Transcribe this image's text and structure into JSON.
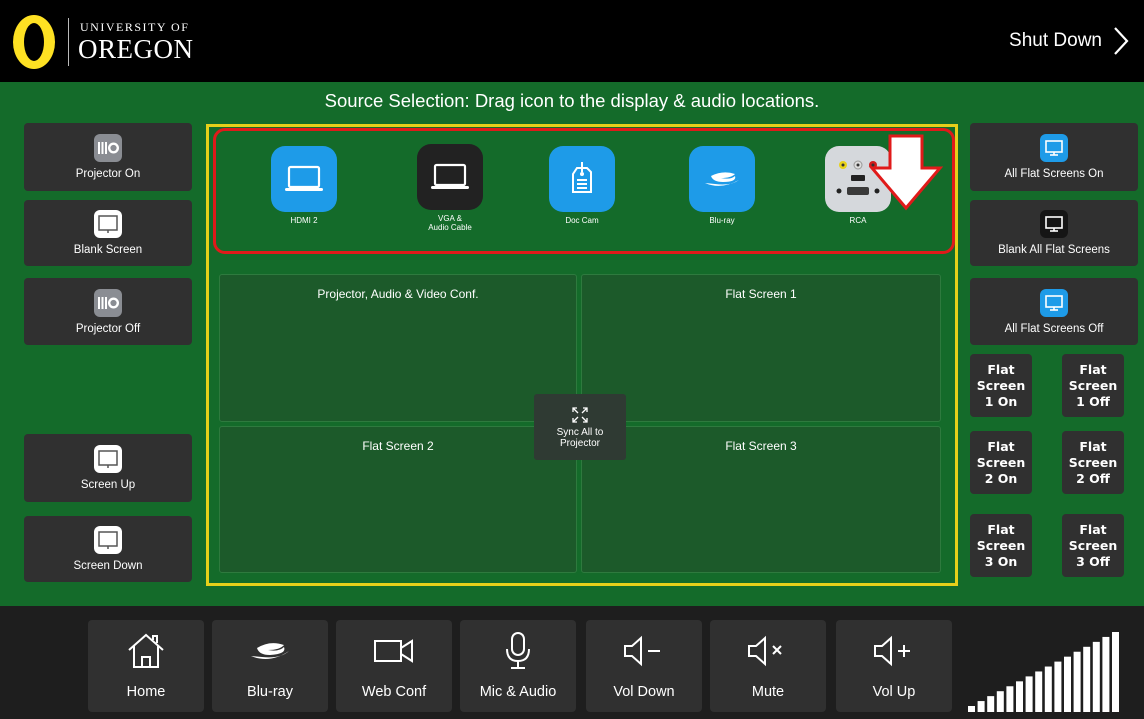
{
  "header": {
    "logo_top": "UNIVERSITY OF",
    "logo_main": "OREGON",
    "shutdown_label": "Shut Down"
  },
  "instruction": "Source Selection: Drag icon to the display & audio locations.",
  "left_buttons": [
    {
      "label": "Projector On",
      "icon": "projector-icon"
    },
    {
      "label": "Blank Screen",
      "icon": "screen-icon"
    },
    {
      "label": "Projector Off",
      "icon": "projector-icon"
    },
    {
      "label": "Screen Up",
      "icon": "screen-icon"
    },
    {
      "label": "Screen Down",
      "icon": "screen-icon"
    }
  ],
  "right_buttons": [
    {
      "label": "All Flat Screens On",
      "icon": "monitor-blue-icon"
    },
    {
      "label": "Blank All Flat Screens",
      "icon": "monitor-black-icon"
    },
    {
      "label": "All Flat Screens Off",
      "icon": "monitor-blue-icon"
    }
  ],
  "flat_screen_buttons": [
    {
      "label": "Flat\nScreen\n1 On"
    },
    {
      "label": "Flat\nScreen\n1 Off"
    },
    {
      "label": "Flat\nScreen\n2 On"
    },
    {
      "label": "Flat\nScreen\n2 Off"
    },
    {
      "label": "Flat\nScreen\n3 On"
    },
    {
      "label": "Flat\nScreen\n3 Off"
    }
  ],
  "sources": [
    {
      "label": "HDMI 2",
      "icon": "hdmi-laptop-icon"
    },
    {
      "label": "VGA &\nAudio Cable",
      "icon": "vga-laptop-icon"
    },
    {
      "label": "Doc Cam",
      "icon": "doc-cam-icon"
    },
    {
      "label": "Blu-ray",
      "icon": "blu-ray-icon"
    },
    {
      "label": "RCA",
      "icon": "rca-icon"
    }
  ],
  "zones": [
    {
      "label": "Projector, Audio & Video Conf."
    },
    {
      "label": "Flat Screen 1"
    },
    {
      "label": "Flat Screen 2"
    },
    {
      "label": "Flat Screen 3"
    }
  ],
  "sync_label": "Sync All to\nProjector",
  "bottom_buttons": [
    {
      "label": "Home",
      "icon": "home-icon"
    },
    {
      "label": "Blu-ray",
      "icon": "blu-ray-icon"
    },
    {
      "label": "Web Conf",
      "icon": "video-camera-icon"
    },
    {
      "label": "Mic & Audio",
      "icon": "microphone-icon"
    },
    {
      "label": "Vol Down",
      "icon": "volume-down-icon"
    },
    {
      "label": "Mute",
      "icon": "mute-icon"
    },
    {
      "label": "Vol Up",
      "icon": "volume-up-icon"
    }
  ],
  "volume_meter": {
    "bars": 16,
    "level": 1.0
  },
  "colors": {
    "green": "#146b2a",
    "yellow": "#e6cf1a",
    "red": "#e01a1a",
    "blue": "#1e9be8",
    "uo_yellow": "#fee123"
  }
}
